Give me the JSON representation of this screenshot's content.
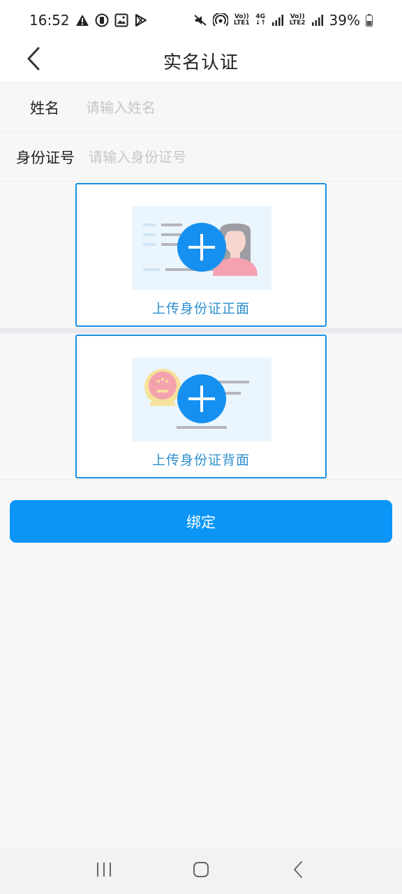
{
  "status_bar": {
    "time": "16:52",
    "battery": "39%",
    "sim1_label_top": "Vo))",
    "sim1_label_bottom": "LTE1",
    "net_label": "4G",
    "sim2_label_top": "Vo))",
    "sim2_label_bottom": "LTE2",
    "left_icons": [
      "warning-icon",
      "circle-app-icon",
      "image-icon",
      "play-store-icon"
    ],
    "right_icons": [
      "mute-icon",
      "hotspot-icon",
      "signal-icon",
      "battery-icon"
    ]
  },
  "header": {
    "title": "实名认证",
    "back_icon": "back-arrow-icon"
  },
  "form": {
    "name_label": "姓名",
    "name_placeholder": "请输入姓名",
    "name_value": "",
    "id_label": "身份证号",
    "id_placeholder": "请输入身份证号",
    "id_value": ""
  },
  "upload": {
    "front_caption": "上传身份证正面",
    "back_caption": "上传身份证背面"
  },
  "actions": {
    "bind_label": "绑定"
  },
  "colors": {
    "accent": "#0b96f7",
    "card_border": "#1a8fe3",
    "caption": "#2d8fcf",
    "placeholder": "#c6c6c6"
  }
}
